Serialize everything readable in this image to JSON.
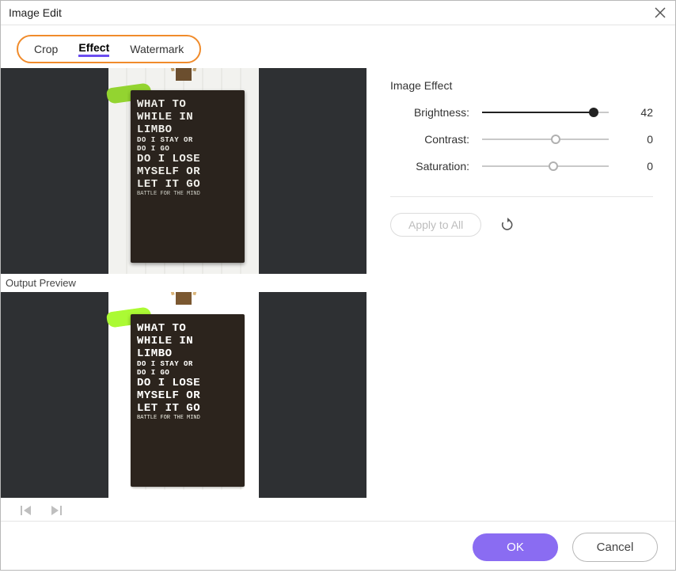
{
  "window": {
    "title": "Image Edit"
  },
  "tabs": {
    "crop": "Crop",
    "effect": "Effect",
    "watermark": "Watermark",
    "active": "effect"
  },
  "preview": {
    "output_label": "Output Preview"
  },
  "board_text": {
    "l1": "WHAT TO",
    "l2": "WHILE IN",
    "l3": "LIMBO",
    "l4": "DO I STAY OR",
    "l5": "DO I GO",
    "l6": "DO I LOSE",
    "l7": "MYSELF OR",
    "l8": "LET IT GO",
    "l9": "BATTLE FOR THE MIND"
  },
  "effect": {
    "section_title": "Image Effect",
    "sliders": {
      "brightness": {
        "label": "Brightness:",
        "value": 42,
        "min": -100,
        "max": 50,
        "thumb_pct": 88,
        "fill_from": 0,
        "fill_to": 88,
        "style": "solid"
      },
      "contrast": {
        "label": "Contrast:",
        "value": 0,
        "min": -100,
        "max": 100,
        "thumb_pct": 58,
        "style": "hollow"
      },
      "saturation": {
        "label": "Saturation:",
        "value": 0,
        "min": -100,
        "max": 100,
        "thumb_pct": 56,
        "style": "hollow"
      }
    },
    "apply_all": "Apply to All"
  },
  "footer": {
    "ok": "OK",
    "cancel": "Cancel"
  },
  "colors": {
    "accent": "#8a6cf2",
    "highlight_ring": "#f08b2b"
  }
}
